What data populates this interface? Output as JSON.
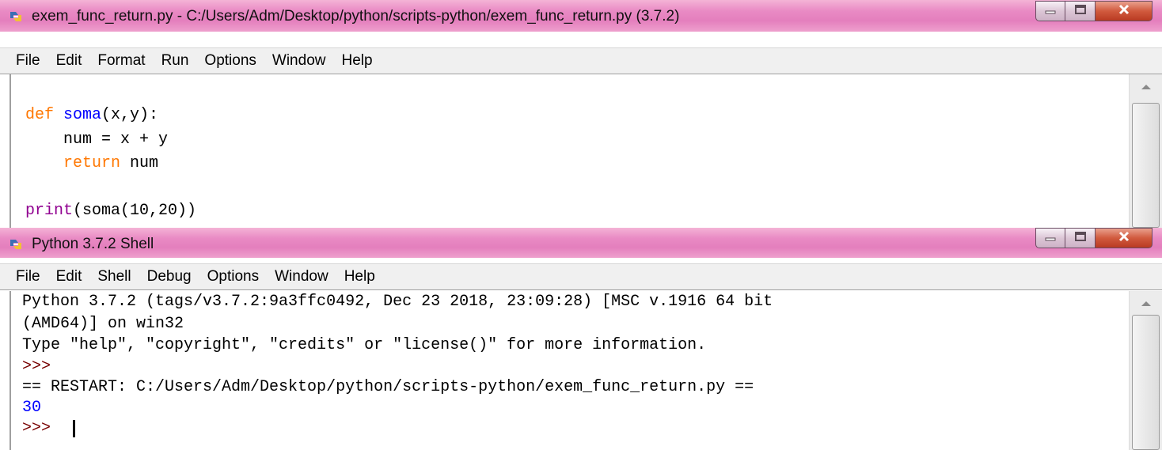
{
  "colors": {
    "keyword": "#ff7700",
    "function_name": "#0000ff",
    "builtin": "#900090",
    "default_text": "#000000",
    "shell_output": "#0000ff",
    "shell_prompt": "#770000",
    "titlebar_pink": "#e47fbd",
    "close_red": "#c74a2e"
  },
  "editor_window": {
    "title": "exem_func_return.py - C:/Users/Adm/Desktop/python/scripts-python/exem_func_return.py (3.7.2)",
    "app_icon": "python-idle-icon",
    "menu": [
      "File",
      "Edit",
      "Format",
      "Run",
      "Options",
      "Window",
      "Help"
    ],
    "code": {
      "line1": {
        "kw": "def",
        "name": "soma",
        "rest": "(x,y):"
      },
      "line2": {
        "text": "    num = x + y"
      },
      "line3": {
        "indent": "    ",
        "kw": "return",
        "rest": " num"
      },
      "line4": {
        "builtin": "print",
        "rest": "(soma(10,20))"
      }
    }
  },
  "shell_window": {
    "title": "Python 3.7.2 Shell",
    "app_icon": "python-idle-icon",
    "menu": [
      "File",
      "Edit",
      "Shell",
      "Debug",
      "Options",
      "Window",
      "Help"
    ],
    "lines": {
      "banner1": "Python 3.7.2 (tags/v3.7.2:9a3ffc0492, Dec 23 2018, 23:09:28) [MSC v.1916 64 bit",
      "banner2": "(AMD64)] on win32",
      "banner3": "Type \"help\", \"copyright\", \"credits\" or \"license()\" for more information.",
      "prompt1": ">>>",
      "restart": "== RESTART: C:/Users/Adm/Desktop/python/scripts-python/exem_func_return.py ==",
      "output": "30",
      "prompt2": ">>> "
    }
  }
}
